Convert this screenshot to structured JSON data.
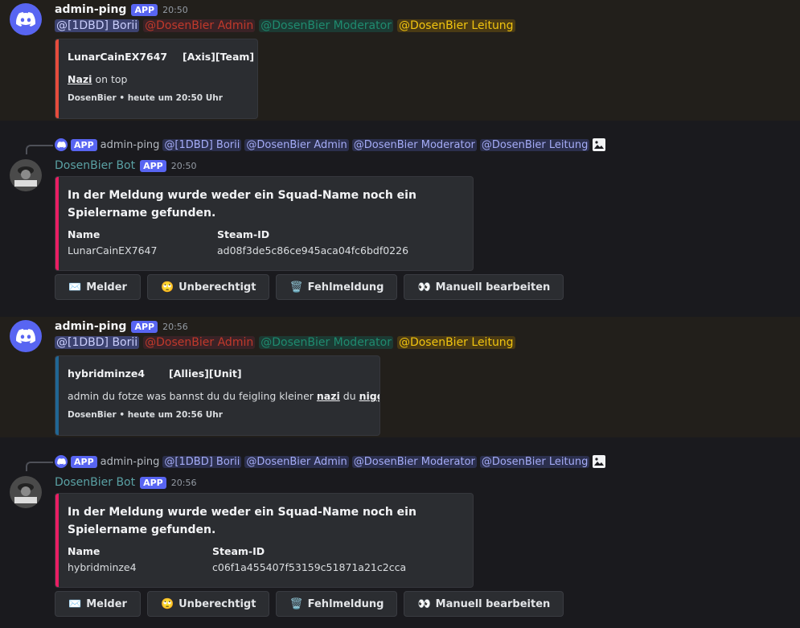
{
  "messages": [
    {
      "type": "report",
      "username": "admin-ping",
      "badge": "APP",
      "time": "20:50",
      "mentions": [
        "@[1DBD] Borii",
        "@DosenBier Admin",
        "@DosenBier Moderator",
        "@DosenBier Leitung"
      ],
      "embed": {
        "player": "LunarCainEX7647",
        "team": "[Axis][Team]",
        "desc_bold": "Nazi",
        "desc_rest": " on top",
        "footer": "DosenBier • heute um 20:50 Uhr",
        "color": "#e74c3c"
      }
    },
    {
      "type": "bot",
      "reply": {
        "badge": "APP",
        "username": "admin-ping",
        "mentions": [
          "@[1DBD] Borii",
          "@DosenBier Admin",
          "@DosenBier Moderator",
          "@DosenBier Leitung"
        ]
      },
      "username": "DosenBier Bot",
      "badge": "APP",
      "time": "20:50",
      "embed": {
        "title": "In der Meldung wurde weder ein Squad-Name noch ein Spielername gefunden.",
        "field1_name": "Name",
        "field1_value": "LunarCainEX7647",
        "field2_name": "Steam-ID",
        "field2_value": "ad08f3de5c86ce945aca04fc6bdf0226",
        "color": "#e91e63"
      },
      "buttons": [
        {
          "emoji": "✉️",
          "label": "Melder"
        },
        {
          "emoji": "🙄",
          "label": "Unberechtigt"
        },
        {
          "emoji": "🗑️",
          "label": "Fehlmeldung"
        },
        {
          "emoji": "👀",
          "label": "Manuell bearbeiten"
        }
      ]
    },
    {
      "type": "report",
      "username": "admin-ping",
      "badge": "APP",
      "time": "20:56",
      "mentions": [
        "@[1DBD] Borii",
        "@DosenBier Admin",
        "@DosenBier Moderator",
        "@DosenBier Leitung"
      ],
      "embed": {
        "player": "hybridminze4",
        "team": "[Allies][Unit]",
        "desc_text": "admin du fotze was bannst du du feigling kleiner ",
        "desc_b1": "nazi",
        "desc_mid": " du ",
        "desc_b2": "nigger",
        "footer": "DosenBier • heute um 20:56 Uhr",
        "color": "#206694"
      }
    },
    {
      "type": "bot",
      "reply": {
        "badge": "APP",
        "username": "admin-ping",
        "mentions": [
          "@[1DBD] Borii",
          "@DosenBier Admin",
          "@DosenBier Moderator",
          "@DosenBier Leitung"
        ]
      },
      "username": "DosenBier Bot",
      "badge": "APP",
      "time": "20:56",
      "embed": {
        "title": "In der Meldung wurde weder ein Squad-Name noch ein Spielername gefunden.",
        "field1_name": "Name",
        "field1_value": "hybridminze4",
        "field2_name": "Steam-ID",
        "field2_value": "c06f1a455407f53159c51871a21c2cca",
        "color": "#e91e63"
      },
      "buttons": [
        {
          "emoji": "✉️",
          "label": "Melder"
        },
        {
          "emoji": "🙄",
          "label": "Unberechtigt"
        },
        {
          "emoji": "🗑️",
          "label": "Fehlmeldung"
        },
        {
          "emoji": "👀",
          "label": "Manuell bearbeiten"
        }
      ]
    }
  ]
}
